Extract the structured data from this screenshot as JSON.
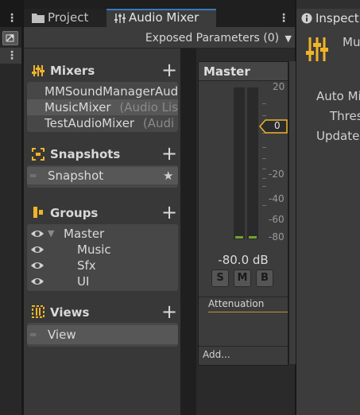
{
  "left_strip": {
    "menu": "⋮"
  },
  "tabs": {
    "project": "Project",
    "audio_mixer": "Audio Mixer",
    "menu": "⋮"
  },
  "toolbar": {
    "exposed_parameters": "Exposed Parameters (0)"
  },
  "mixers": {
    "title": "Mixers",
    "items": [
      {
        "name": "MMSoundManagerAud",
        "note": ""
      },
      {
        "name": "MusicMixer",
        "note": "(Audio Lis"
      },
      {
        "name": "TestAudioMixer",
        "note": "(Audi"
      }
    ]
  },
  "snapshots": {
    "title": "Snapshots",
    "items": [
      {
        "name": "Snapshot"
      }
    ]
  },
  "groups": {
    "title": "Groups",
    "items": [
      {
        "name": "Master"
      },
      {
        "name": "Music"
      },
      {
        "name": "Sfx"
      },
      {
        "name": "UI"
      }
    ]
  },
  "views": {
    "title": "Views",
    "items": [
      {
        "name": "View"
      }
    ]
  },
  "master_strip": {
    "title": "Master",
    "level_marker": "0",
    "attenuation": "-80.0 dB",
    "solo": "S",
    "mute": "M",
    "bypass": "B",
    "effect": "Attenuation",
    "add": "Add...",
    "ticks": [
      "20",
      "0",
      "-20",
      "-40",
      "-60",
      "-80"
    ]
  },
  "inspector": {
    "tab": "Inspect",
    "title": "Mu",
    "labels": [
      "Auto Mi",
      "Thres",
      "Update"
    ]
  },
  "colors": {
    "accent": "#f0b429",
    "meter": "#6fa332",
    "selection": "#3a79bb"
  }
}
